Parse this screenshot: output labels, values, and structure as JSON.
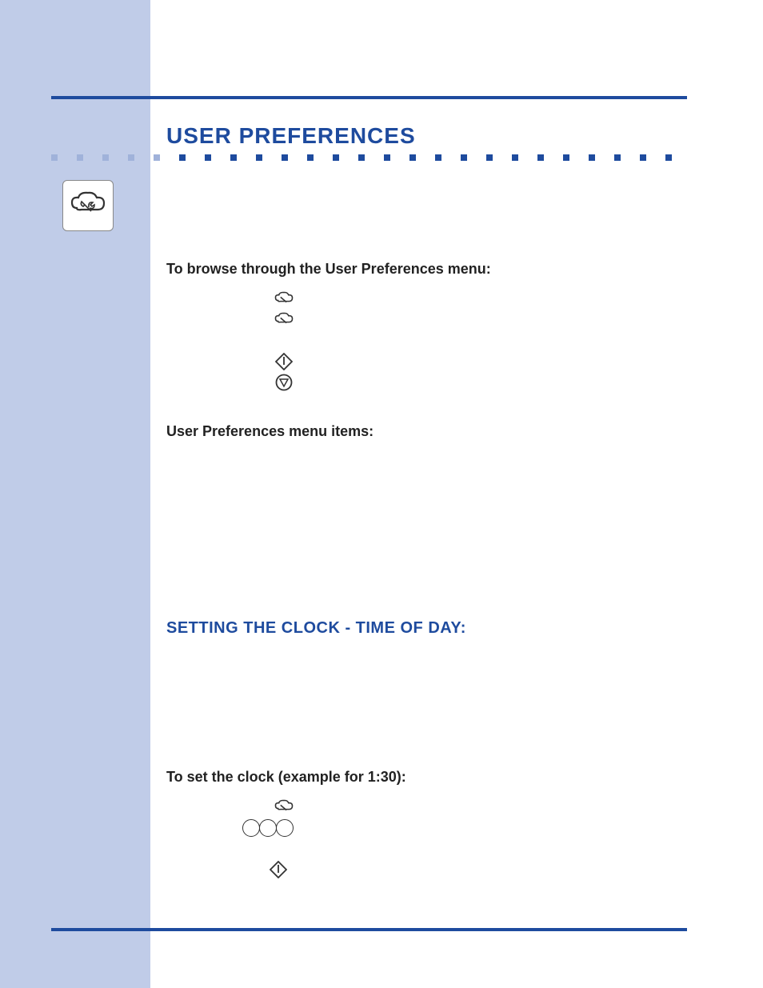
{
  "title": "USER PREFERENCES",
  "intro_heading": "To browse through the User Preferences menu:",
  "menu_heading": "User Preferences menu items:",
  "section_heading": "SETTING THE CLOCK - TIME OF DAY:",
  "clock_heading": "To set the clock (example for 1:30):",
  "icons": {
    "sidebar_icon": "wrench-cloud-icon",
    "wrench_small": "wrench-cloud-icon",
    "start_diamond": "start-icon",
    "stop_triangle": "stop-icon",
    "numpad": "number-keys-icon"
  }
}
